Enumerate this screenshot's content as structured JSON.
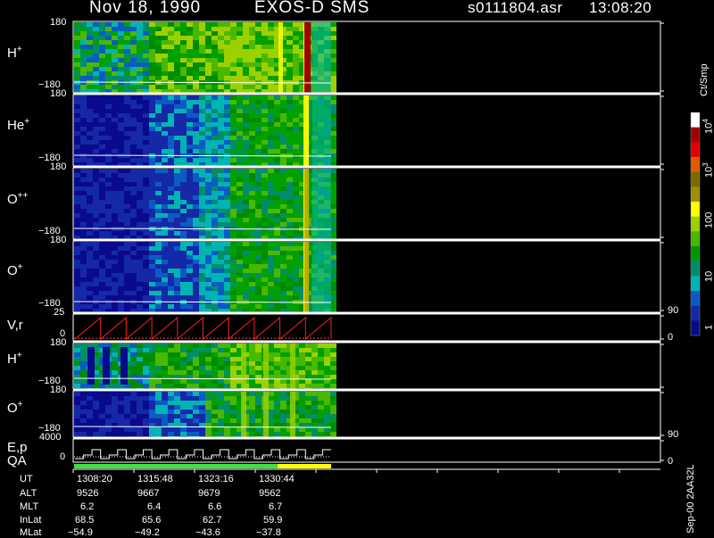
{
  "header": {
    "date": "Nov 18, 1990",
    "instrument": "EXOS-D SMS",
    "file": "s0111804.asr",
    "time": "13:08:20"
  },
  "panels": [
    {
      "label": "H",
      "charge": "+",
      "ymax": "180",
      "ymin": "−180"
    },
    {
      "label": "He",
      "charge": "+",
      "ymax": "180",
      "ymin": "−180"
    },
    {
      "label": "O",
      "charge": "++",
      "ymax": "180",
      "ymin": "−180"
    },
    {
      "label": "O",
      "charge": "+",
      "ymax": "180",
      "ymin": "−180"
    },
    {
      "label": "V,r",
      "charge": "",
      "ymax": "25",
      "ymin": "0"
    },
    {
      "label": "H",
      "charge": "+",
      "ymax": "180",
      "ymin": "−180"
    },
    {
      "label": "O",
      "charge": "+",
      "ymax": "180",
      "ymin": "−180"
    },
    {
      "label": "E,p",
      "charge": "",
      "ymax": "4000",
      "ymin": "0"
    }
  ],
  "qa_label": "QA",
  "right_ticks": {
    "vr_top": "90",
    "vr_bottom": "0",
    "ep_top": "90",
    "ep_bottom": "0"
  },
  "colorbar": {
    "unit": "Ct/Smp",
    "labels": [
      {
        "base": "10",
        "exp": "4"
      },
      {
        "base": "10",
        "exp": "3"
      },
      {
        "base": "100",
        "exp": ""
      },
      {
        "base": "10",
        "exp": ""
      },
      {
        "base": "1",
        "exp": ""
      }
    ],
    "colors": [
      "#ffffff",
      "#a00000",
      "#e00000",
      "#e05a00",
      "#7a6a00",
      "#9e9000",
      "#ffff00",
      "#9cd100",
      "#4ab800",
      "#009600",
      "#008e6a",
      "#00b4b4",
      "#0a5cc4",
      "#1528a8",
      "#0a0a8c"
    ]
  },
  "ephemeris": {
    "rows": [
      {
        "name": "UT",
        "values": [
          "1308:20",
          "1315:48",
          "1323:16",
          "1330:44"
        ]
      },
      {
        "name": "ALT",
        "values": [
          "9526",
          "9667",
          "9679",
          "9562"
        ]
      },
      {
        "name": "MLT",
        "values": [
          "6.2",
          "6.4",
          "6.6",
          "6.7"
        ]
      },
      {
        "name": "InLat",
        "values": [
          "68.5",
          "65.6",
          "62.7",
          "59.9"
        ]
      },
      {
        "name": "MLat",
        "values": [
          "−54.9",
          "−49.2",
          "−43.6",
          "−37.8"
        ]
      }
    ]
  },
  "footer": "Sep-00 2AA32L",
  "chart_data": {
    "type": "heatmap",
    "title": "Nov 18, 1990    EXOS-D SMS",
    "x_ticks_ut": [
      "1308:20",
      "1315:48",
      "1323:16",
      "1330:44"
    ],
    "x_range_ut": [
      "13:08:20",
      "13:38:00"
    ],
    "data_extends_to_fraction": 0.455,
    "panels": [
      {
        "name": "H+",
        "ylim": [
          -180,
          180
        ],
        "dominant_levels": [
          "blue",
          "cyan",
          "green",
          "yellow",
          "red"
        ]
      },
      {
        "name": "He+",
        "ylim": [
          -180,
          180
        ],
        "dominant_levels": [
          "dark blue",
          "cyan",
          "green",
          "yellow"
        ]
      },
      {
        "name": "O++",
        "ylim": [
          -180,
          180
        ],
        "dominant_levels": [
          "dark blue",
          "cyan",
          "green",
          "yellow"
        ]
      },
      {
        "name": "O+",
        "ylim": [
          -180,
          180
        ],
        "dominant_levels": [
          "dark blue",
          "cyan",
          "green",
          "yellow",
          "red"
        ]
      },
      {
        "name": "V,r",
        "ylim": [
          0,
          25
        ],
        "right_ylim": [
          0,
          90
        ]
      },
      {
        "name": "H+",
        "ylim": [
          -180,
          180
        ]
      },
      {
        "name": "O+",
        "ylim": [
          -180,
          180
        ]
      },
      {
        "name": "E,p",
        "ylim": [
          0,
          4000
        ],
        "right_ylim": [
          0,
          90
        ]
      }
    ],
    "colorbar": {
      "scale": "log",
      "range": [
        1,
        10000
      ],
      "unit": "Ct/Smp"
    },
    "grid": false
  }
}
